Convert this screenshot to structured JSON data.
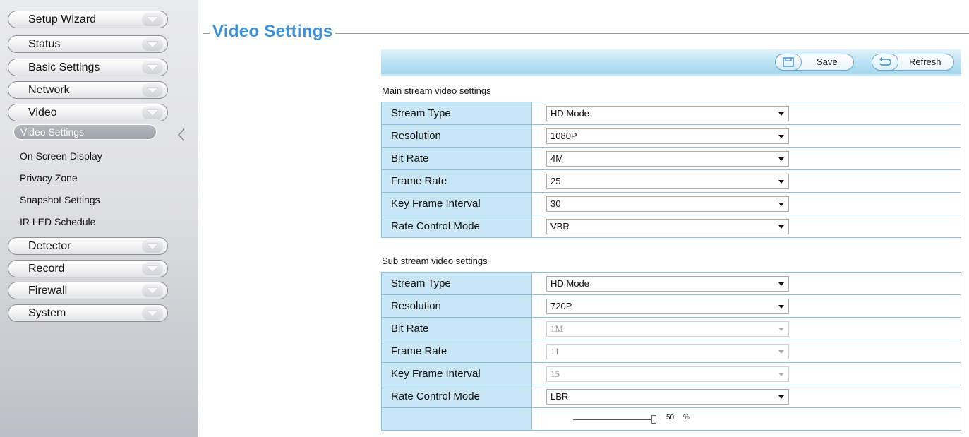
{
  "sidebar": {
    "menu": [
      {
        "label": "Setup Wizard"
      },
      {
        "label": "Status"
      },
      {
        "label": "Basic Settings"
      },
      {
        "label": "Network"
      },
      {
        "label": "Video"
      },
      {
        "label": "Detector"
      },
      {
        "label": "Record"
      },
      {
        "label": "Firewall"
      },
      {
        "label": "System"
      }
    ],
    "video_submenu": [
      {
        "label": "Video Settings",
        "active": true
      },
      {
        "label": "On Screen Display"
      },
      {
        "label": "Privacy Zone"
      },
      {
        "label": "Snapshot Settings"
      },
      {
        "label": "IR LED Schedule"
      }
    ]
  },
  "page": {
    "title": "Video Settings"
  },
  "toolbar": {
    "save_label": "Save",
    "refresh_label": "Refresh"
  },
  "main_stream": {
    "title": "Main stream video settings",
    "rows": [
      {
        "label": "Stream Type",
        "value": "HD Mode"
      },
      {
        "label": "Resolution",
        "value": "1080P"
      },
      {
        "label": "Bit Rate",
        "value": "4M"
      },
      {
        "label": "Frame Rate",
        "value": "25"
      },
      {
        "label": "Key Frame Interval",
        "value": "30"
      },
      {
        "label": "Rate Control Mode",
        "value": "VBR"
      }
    ]
  },
  "sub_stream": {
    "title": "Sub stream video settings",
    "rows": [
      {
        "label": "Stream Type",
        "value": "HD Mode"
      },
      {
        "label": "Resolution",
        "value": "720P"
      },
      {
        "label": "Bit Rate",
        "value": "1M",
        "disabled": true
      },
      {
        "label": "Frame Rate",
        "value": "11",
        "disabled": true
      },
      {
        "label": "Key Frame Interval",
        "value": "15",
        "disabled": true
      },
      {
        "label": "Rate Control Mode",
        "value": "LBR"
      }
    ],
    "slider": {
      "value": "50",
      "unit": "%"
    }
  },
  "colors": {
    "title_blue": "#3b8fd4",
    "label_cell_bg": "#c8e6f5",
    "table_border": "#8bbfd9",
    "toolbar_bg": "#b9e1f3"
  },
  "icons": {
    "menu_expand": "chevron-down-icon",
    "save": "save-icon",
    "refresh": "refresh-icon",
    "active_pointer": "pointer-left-icon"
  }
}
